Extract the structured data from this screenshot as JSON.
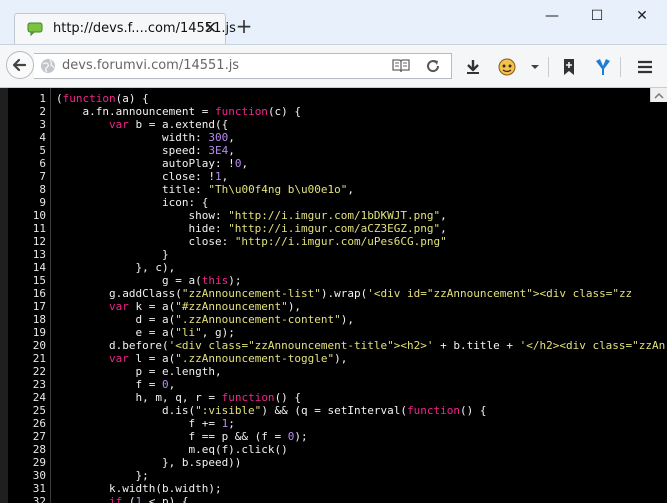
{
  "tab": {
    "title": "http://devs.f....com/14551.js",
    "close": "✕"
  },
  "new_tab": "+",
  "window_controls": {
    "minimize": "—",
    "maximize": "☐",
    "close": "✕"
  },
  "address": {
    "url": "devs.forumvi.com/14551.js"
  },
  "icons": {
    "favicon": "speech-bubble-icon",
    "back": "back-arrow-icon",
    "site": "globe-icon",
    "reader": "reader-view-icon",
    "reload": "reload-icon",
    "download": "download-icon",
    "user": "user-avatar-icon",
    "dropdown": "chevron-down-icon",
    "bookmark": "bookmark-icon",
    "shield": "shield-icon",
    "menu": "hamburger-menu-icon"
  },
  "colors": {
    "keyword": "#f0248a",
    "string": "#e3e07a",
    "number": "#b88cf0",
    "text": "#f2f2f2",
    "background": "#000000"
  },
  "code": {
    "line_numbers": [
      "1",
      "2",
      "3",
      "4",
      "5",
      "6",
      "7",
      "8",
      "9",
      "10",
      "11",
      "12",
      "13",
      "14",
      "15",
      "16",
      "17",
      "18",
      "19",
      "20",
      "21",
      "22",
      "23",
      "24",
      "25",
      "26",
      "27",
      "28",
      "29",
      "30",
      "31",
      "32"
    ],
    "lines": [
      [
        {
          "t": "p",
          "v": "("
        },
        {
          "t": "k",
          "v": "function"
        },
        {
          "t": "p",
          "v": "(a) {"
        }
      ],
      [
        {
          "t": "p",
          "v": "    a.fn.announcement = "
        },
        {
          "t": "k",
          "v": "function"
        },
        {
          "t": "p",
          "v": "(c) {"
        }
      ],
      [
        {
          "t": "p",
          "v": "        "
        },
        {
          "t": "k",
          "v": "var"
        },
        {
          "t": "p",
          "v": " b = a.extend({"
        }
      ],
      [
        {
          "t": "p",
          "v": "                width: "
        },
        {
          "t": "n",
          "v": "300"
        },
        {
          "t": "p",
          "v": ","
        }
      ],
      [
        {
          "t": "p",
          "v": "                speed: "
        },
        {
          "t": "n",
          "v": "3E4"
        },
        {
          "t": "p",
          "v": ","
        }
      ],
      [
        {
          "t": "p",
          "v": "                autoPlay: !"
        },
        {
          "t": "n",
          "v": "0"
        },
        {
          "t": "p",
          "v": ","
        }
      ],
      [
        {
          "t": "p",
          "v": "                close: !"
        },
        {
          "t": "n",
          "v": "1"
        },
        {
          "t": "p",
          "v": ","
        }
      ],
      [
        {
          "t": "p",
          "v": "                title: "
        },
        {
          "t": "s",
          "v": "\"Th\\u00f4ng b\\u00e1o\""
        },
        {
          "t": "p",
          "v": ","
        }
      ],
      [
        {
          "t": "p",
          "v": "                icon: {"
        }
      ],
      [
        {
          "t": "p",
          "v": "                    show: "
        },
        {
          "t": "s",
          "v": "\"http://i.imgur.com/1bDKWJT.png\""
        },
        {
          "t": "p",
          "v": ","
        }
      ],
      [
        {
          "t": "p",
          "v": "                    hide: "
        },
        {
          "t": "s",
          "v": "\"http://i.imgur.com/aCZ3EGZ.png\""
        },
        {
          "t": "p",
          "v": ","
        }
      ],
      [
        {
          "t": "p",
          "v": "                    close: "
        },
        {
          "t": "s",
          "v": "\"http://i.imgur.com/uPes6CG.png\""
        }
      ],
      [
        {
          "t": "p",
          "v": "                }"
        }
      ],
      [
        {
          "t": "p",
          "v": "            }, c),"
        }
      ],
      [
        {
          "t": "p",
          "v": "                g = a("
        },
        {
          "t": "k",
          "v": "this"
        },
        {
          "t": "p",
          "v": ");"
        }
      ],
      [
        {
          "t": "p",
          "v": "        g.addClass("
        },
        {
          "t": "s",
          "v": "\"zzAnnouncement-list\""
        },
        {
          "t": "p",
          "v": ").wrap("
        },
        {
          "t": "s",
          "v": "'<div id=\"zzAnnouncement\"><div class=\"zz"
        }
      ],
      [
        {
          "t": "p",
          "v": "        "
        },
        {
          "t": "k",
          "v": "var"
        },
        {
          "t": "p",
          "v": " k = a("
        },
        {
          "t": "s",
          "v": "\"#zzAnnouncement\""
        },
        {
          "t": "p",
          "v": "),"
        }
      ],
      [
        {
          "t": "p",
          "v": "            d = a("
        },
        {
          "t": "s",
          "v": "\".zzAnnouncement-content\""
        },
        {
          "t": "p",
          "v": "),"
        }
      ],
      [
        {
          "t": "p",
          "v": "            e = a("
        },
        {
          "t": "s",
          "v": "\"li\""
        },
        {
          "t": "p",
          "v": ", g);"
        }
      ],
      [
        {
          "t": "p",
          "v": "        d.before("
        },
        {
          "t": "s",
          "v": "'<div class=\"zzAnnouncement-title\"><h2>'"
        },
        {
          "t": "p",
          "v": " + b.title + "
        },
        {
          "t": "s",
          "v": "'</h2><div class=\"zzAn"
        }
      ],
      [
        {
          "t": "p",
          "v": "        "
        },
        {
          "t": "k",
          "v": "var"
        },
        {
          "t": "p",
          "v": " l = a("
        },
        {
          "t": "s",
          "v": "\".zzAnnouncement-toggle\""
        },
        {
          "t": "p",
          "v": "),"
        }
      ],
      [
        {
          "t": "p",
          "v": "            p = e.length,"
        }
      ],
      [
        {
          "t": "p",
          "v": "            f = "
        },
        {
          "t": "n",
          "v": "0"
        },
        {
          "t": "p",
          "v": ","
        }
      ],
      [
        {
          "t": "p",
          "v": "            h, m, q, r = "
        },
        {
          "t": "k",
          "v": "function"
        },
        {
          "t": "p",
          "v": "() {"
        }
      ],
      [
        {
          "t": "p",
          "v": "                d.is("
        },
        {
          "t": "s",
          "v": "\":visible\""
        },
        {
          "t": "p",
          "v": ") && (q = setInterval("
        },
        {
          "t": "k",
          "v": "function"
        },
        {
          "t": "p",
          "v": "() {"
        }
      ],
      [
        {
          "t": "p",
          "v": "                    f += "
        },
        {
          "t": "n",
          "v": "1"
        },
        {
          "t": "p",
          "v": ";"
        }
      ],
      [
        {
          "t": "p",
          "v": "                    f == p && (f = "
        },
        {
          "t": "n",
          "v": "0"
        },
        {
          "t": "p",
          "v": ");"
        }
      ],
      [
        {
          "t": "p",
          "v": "                    m.eq(f).click()"
        }
      ],
      [
        {
          "t": "p",
          "v": "                }, b.speed))"
        }
      ],
      [
        {
          "t": "p",
          "v": "            };"
        }
      ],
      [
        {
          "t": "p",
          "v": "        k.width(b.width);"
        }
      ],
      [
        {
          "t": "p",
          "v": "        "
        },
        {
          "t": "k",
          "v": "if"
        },
        {
          "t": "p",
          "v": " ("
        },
        {
          "t": "n",
          "v": "1"
        },
        {
          "t": "p",
          "v": " < p) {"
        }
      ]
    ]
  }
}
